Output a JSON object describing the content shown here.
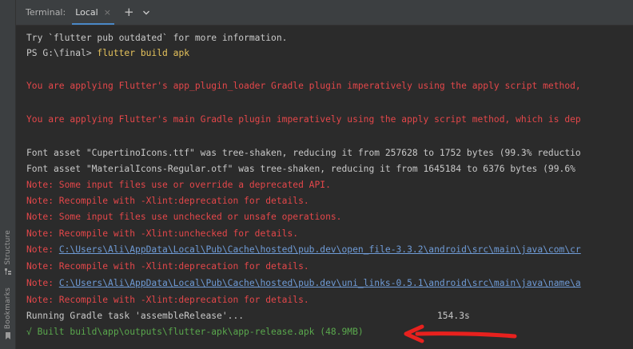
{
  "sidebar": {
    "structure_label": "Structure",
    "bookmarks_label": "Bookmarks"
  },
  "header": {
    "terminal_label": "Terminal:",
    "tab_local": "Local",
    "close_glyph": "×",
    "add_glyph": "+"
  },
  "terminal": {
    "l1": "Try `flutter pub outdated` for more information.",
    "l2_prompt": "PS G:\\final> ",
    "l2_cmd": "flutter build apk",
    "l3": "You are applying Flutter's app_plugin_loader Gradle plugin imperatively using the apply script method,",
    "l4": "You are applying Flutter's main Gradle plugin imperatively using the apply script method, which is dep",
    "l5": "Font asset \"CupertinoIcons.ttf\" was tree-shaken, reducing it from 257628 to 1752 bytes (99.3% reductio",
    "l6": "Font asset \"MaterialIcons-Regular.otf\" was tree-shaken, reducing it from 1645184 to 6376 bytes (99.6%",
    "l7": "Note: Some input files use or override a deprecated API.",
    "l8": "Note: Recompile with -Xlint:deprecation for details.",
    "l9": "Note: Some input files use unchecked or unsafe operations.",
    "l10": "Note: Recompile with -Xlint:unchecked for details.",
    "l11_prefix": "Note: ",
    "l11_path": "C:\\Users\\Ali\\AppData\\Local\\Pub\\Cache\\hosted\\pub.dev\\open_file-3.3.2\\android\\src\\main\\java\\com\\cr",
    "l12": "Note: Recompile with -Xlint:deprecation for details.",
    "l13_prefix": "Note: ",
    "l13_path": "C:\\Users\\Ali\\AppData\\Local\\Pub\\Cache\\hosted\\pub.dev\\uni_links-0.5.1\\android\\src\\main\\java\\name\\a",
    "l14": "Note: Recompile with -Xlint:deprecation for details.",
    "l15": "Running Gradle task 'assembleRelease'...",
    "time": "154.3s",
    "l16": "√ Built build\\app\\outputs\\flutter-apk\\app-release.apk (48.9MB)"
  },
  "colors": {
    "background": "#2b2b2b",
    "error_red": "#e4474a",
    "path_blue": "#6f9bd6",
    "success_green": "#5aa84d",
    "command_yellow": "#e6c35c",
    "annotation_arrow": "#e8211e"
  }
}
